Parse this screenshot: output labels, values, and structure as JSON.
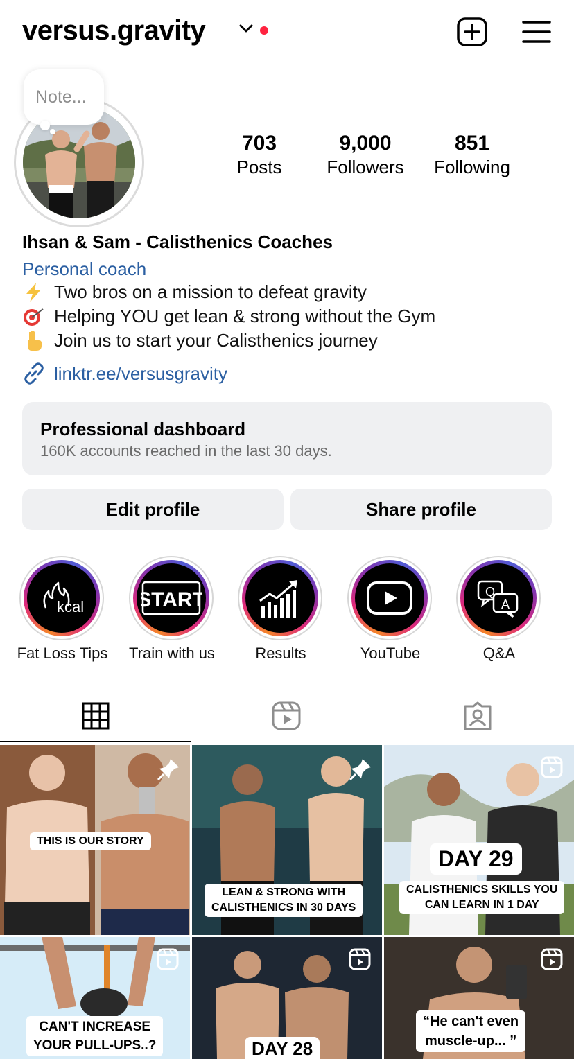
{
  "header": {
    "username": "versus.gravity"
  },
  "note": {
    "placeholder": "Note..."
  },
  "stats": {
    "posts": {
      "value": "703",
      "label": "Posts"
    },
    "followers": {
      "value": "9,000",
      "label": "Followers"
    },
    "following": {
      "value": "851",
      "label": "Following"
    }
  },
  "bio": {
    "name": "Ihsan & Sam - Calisthenics Coaches",
    "category": "Personal coach",
    "lines": [
      "Two bros on a mission to defeat gravity",
      "Helping YOU get lean & strong without the Gym",
      "Join us to start your Calisthenics journey"
    ],
    "link": "linktr.ee/versusgravity"
  },
  "dashboard": {
    "title": "Professional dashboard",
    "subtitle": "160K accounts reached in the last 30 days."
  },
  "buttons": {
    "edit": "Edit profile",
    "share": "Share profile"
  },
  "highlights": [
    {
      "label": "Fat Loss Tips",
      "icon": "kcal-icon",
      "text": "kcal"
    },
    {
      "label": "Train with us",
      "icon": "start-icon",
      "text": "START"
    },
    {
      "label": "Results",
      "icon": "growth-chart-icon"
    },
    {
      "label": "YouTube",
      "icon": "youtube-play-icon"
    },
    {
      "label": "Q&A",
      "icon": "qa-bubbles-icon",
      "q": "Q",
      "a": "A"
    }
  ],
  "grid": [
    {
      "caption": "THIS IS OUR STORY",
      "pinned": true
    },
    {
      "caption_lines": [
        "LEAN & STRONG WITH",
        "CALISTHENICS IN 30 DAYS"
      ],
      "pinned": true
    },
    {
      "day": "DAY 29",
      "caption_lines": [
        "CALISTHENICS SKILLS YOU",
        "CAN LEARN IN 1 DAY"
      ],
      "reel": true
    },
    {
      "caption_lines": [
        "CAN'T INCREASE",
        "YOUR PULL-UPS..?"
      ],
      "reel": true
    },
    {
      "day": "DAY 28",
      "reel": true
    },
    {
      "caption_lines": [
        "“He can't even",
        "muscle-up... ”"
      ],
      "reel": true
    }
  ],
  "colors": {
    "link": "#2b5fa2",
    "notification_dot": "#ff2340",
    "button_bg": "#eff0f2"
  }
}
